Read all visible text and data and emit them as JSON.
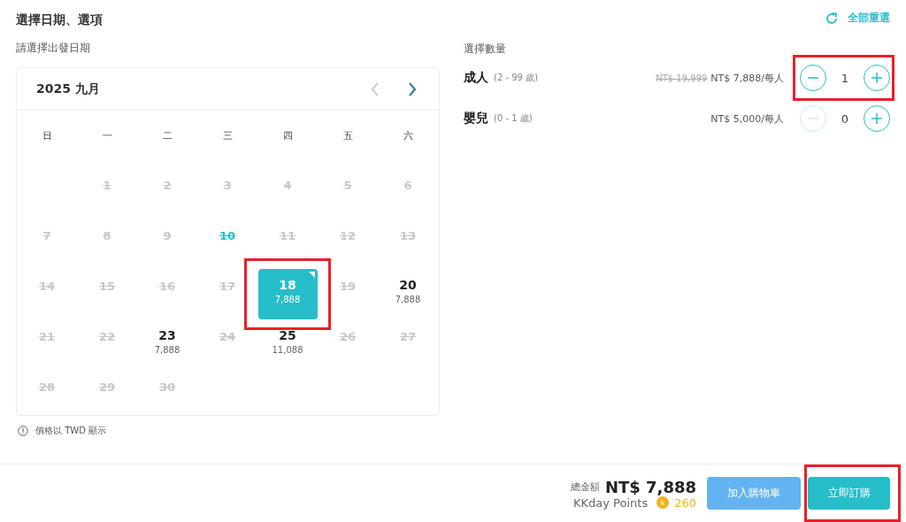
{
  "title": "選擇日期、選項",
  "reset": {
    "label": "全部重選"
  },
  "date_section": {
    "label": "請選擇出發日期",
    "month": "2025 九月",
    "prev_disabled": true,
    "weekdays": [
      "日",
      "一",
      "二",
      "三",
      "四",
      "五",
      "六"
    ],
    "days": [
      {
        "kind": "blank"
      },
      {
        "day": "1",
        "kind": "past"
      },
      {
        "day": "2",
        "kind": "past"
      },
      {
        "day": "3",
        "kind": "past"
      },
      {
        "day": "4",
        "kind": "past"
      },
      {
        "day": "5",
        "kind": "past"
      },
      {
        "day": "6",
        "kind": "past"
      },
      {
        "day": "7",
        "kind": "past"
      },
      {
        "day": "8",
        "kind": "past"
      },
      {
        "day": "9",
        "kind": "past"
      },
      {
        "day": "10",
        "kind": "today"
      },
      {
        "day": "11",
        "kind": "past"
      },
      {
        "day": "12",
        "kind": "past"
      },
      {
        "day": "13",
        "kind": "past"
      },
      {
        "day": "14",
        "kind": "past"
      },
      {
        "day": "15",
        "kind": "past"
      },
      {
        "day": "16",
        "kind": "past"
      },
      {
        "day": "17",
        "kind": "past"
      },
      {
        "day": "18",
        "kind": "available",
        "price": "7,888",
        "selected": true,
        "highlighted": true
      },
      {
        "day": "19",
        "kind": "past"
      },
      {
        "day": "20",
        "kind": "available",
        "price": "7,888",
        "selected": false,
        "highlighted": false
      },
      {
        "day": "21",
        "kind": "past"
      },
      {
        "day": "22",
        "kind": "past"
      },
      {
        "day": "23",
        "kind": "available",
        "price": "7,888",
        "selected": false,
        "highlighted": false
      },
      {
        "day": "24",
        "kind": "past"
      },
      {
        "day": "25",
        "kind": "available",
        "price": "11,088",
        "selected": false,
        "highlighted": false
      },
      {
        "day": "26",
        "kind": "past"
      },
      {
        "day": "27",
        "kind": "past"
      },
      {
        "day": "28",
        "kind": "past"
      },
      {
        "day": "29",
        "kind": "past"
      },
      {
        "day": "30",
        "kind": "past"
      }
    ],
    "note": "價格以 TWD 顯示"
  },
  "quantity_section": {
    "label": "選擇數量",
    "rows": [
      {
        "name": "成人",
        "age": "(2 - 99 歲)",
        "old_price": "NT$ 19,999",
        "price": "NT$ 7,888/每人",
        "quantity": "1",
        "minus_disabled": false,
        "highlighted": true
      },
      {
        "name": "嬰兒",
        "age": "(0 - 1 歲)",
        "price": "NT$ 5,000/每人",
        "quantity": "0",
        "minus_disabled": true,
        "highlighted": false
      }
    ]
  },
  "footer": {
    "total_label": "總金額",
    "total": "NT$ 7,888",
    "points_label": "KKday Points",
    "coin": "k",
    "points": "260",
    "buttons": [
      {
        "label": "加入購物車",
        "kind": "secondary",
        "highlighted": false
      },
      {
        "label": "立即訂購",
        "kind": "primary",
        "highlighted": true
      }
    ]
  }
}
